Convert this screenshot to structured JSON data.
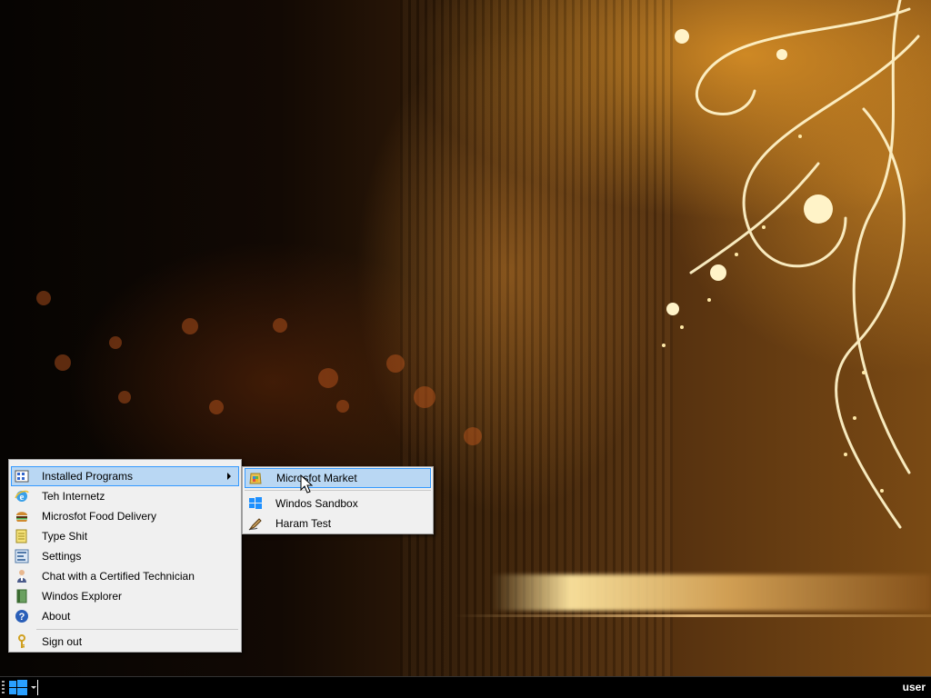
{
  "desktop": {
    "wallpaper_accent": "#d89a3a"
  },
  "start_menu": {
    "items": [
      {
        "label": "Installed Programs",
        "icon": "programs-grid-icon",
        "has_submenu": true,
        "selected": true
      },
      {
        "label": "Teh Internetz",
        "icon": "internet-explorer-icon"
      },
      {
        "label": "Microsfot Food Delivery",
        "icon": "burger-icon"
      },
      {
        "label": "Type Shit",
        "icon": "notepad-icon"
      },
      {
        "label": "Settings",
        "icon": "settings-icon"
      },
      {
        "label": "Chat with a Certified Technician",
        "icon": "technician-icon"
      },
      {
        "label": "Windos Explorer",
        "icon": "explorer-book-icon"
      },
      {
        "label": "About",
        "icon": "help-icon"
      },
      {
        "label": "Sign out",
        "icon": "key-icon"
      }
    ]
  },
  "submenu": {
    "items": [
      {
        "label": "Microsfot Market",
        "icon": "market-icon",
        "selected": true
      },
      {
        "label": "Windos Sandbox",
        "icon": "windows-logo-icon"
      },
      {
        "label": "Haram Test",
        "icon": "pen-icon"
      }
    ]
  },
  "taskbar": {
    "user_label": "user",
    "start_icon": "windows-logo-icon"
  },
  "colors": {
    "menu_bg": "#f0f0f0",
    "selection_bg": "#b9d7f3",
    "selection_border": "#3399ff",
    "taskbar_bg": "#000000"
  }
}
